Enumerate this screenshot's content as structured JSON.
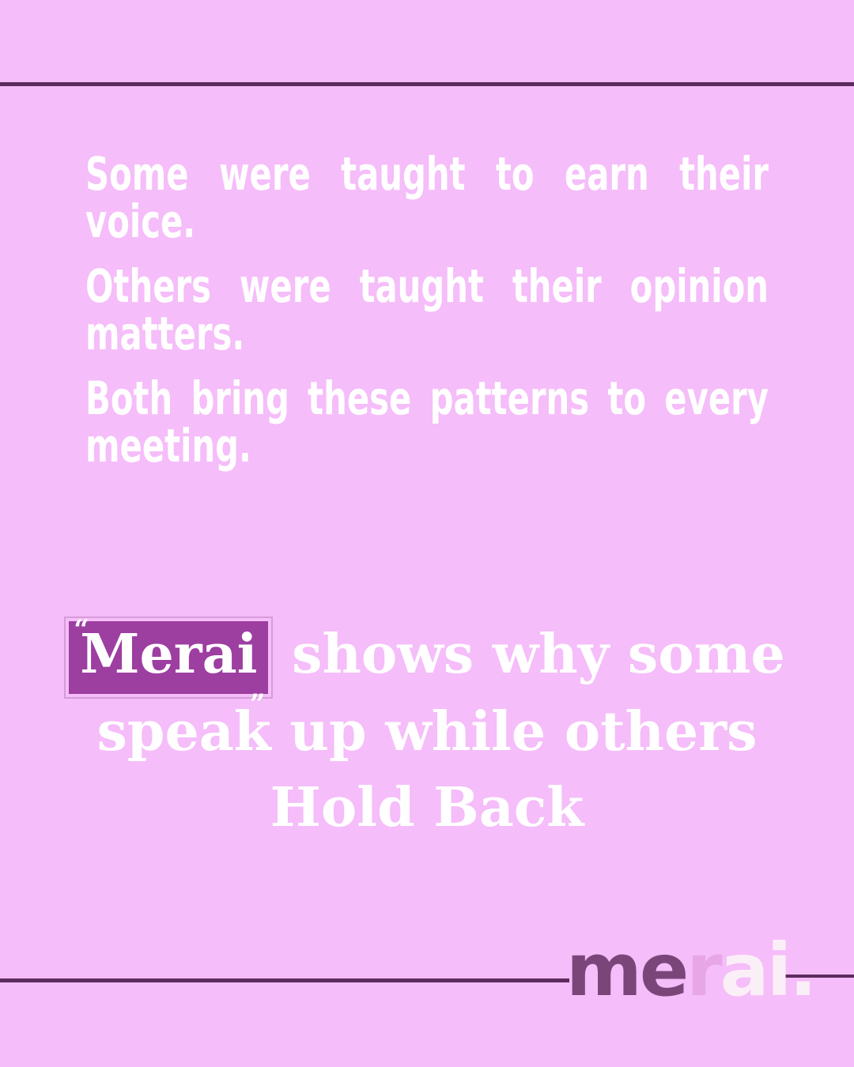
{
  "paragraphs": [
    "Some were taught to earn their voice.",
    "Others were taught their opinion matters.",
    "Both bring these patterns to every meeting."
  ],
  "headline": {
    "brand": "Merai",
    "line1_rest": "shows why some",
    "line2": "speak up while others",
    "line3": "Hold Back",
    "quote_open": "“",
    "quote_close": "”"
  },
  "logo": {
    "part1": "me",
    "part2": "r",
    "part3": "ai."
  },
  "colors": {
    "background": "#f5bdf9",
    "rule": "#5c2c5e",
    "brand_box": "#9d3ea1",
    "text": "#ffffff"
  }
}
